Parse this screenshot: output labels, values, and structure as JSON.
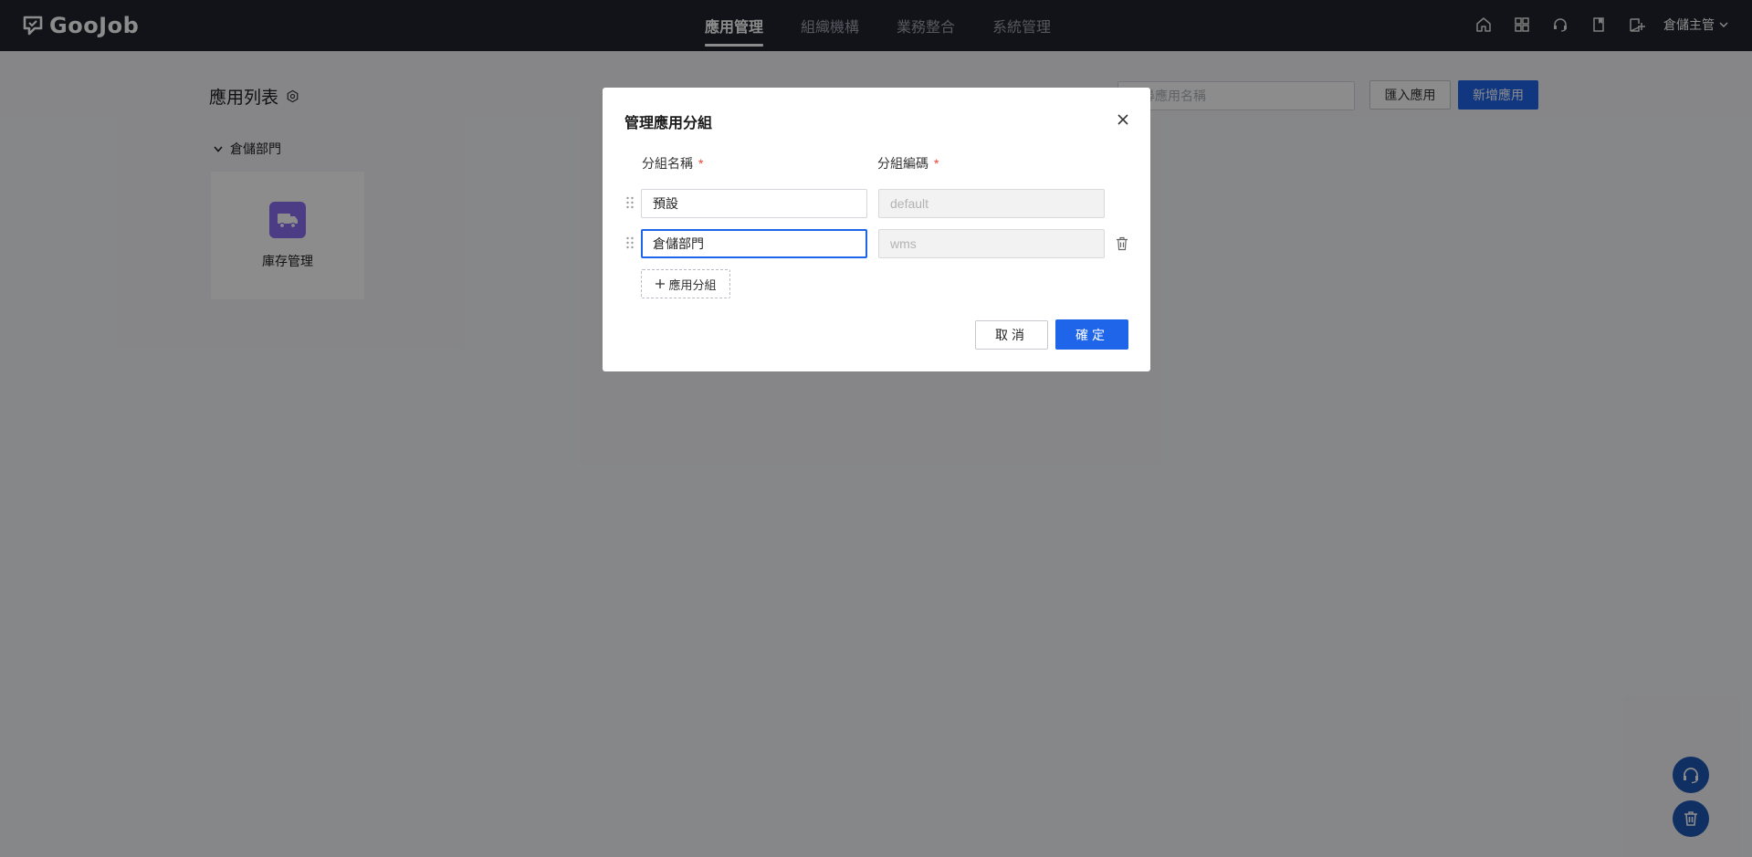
{
  "app": {
    "logo_text": "GooJob"
  },
  "nav": {
    "items": [
      {
        "label": "應用管理",
        "active": true
      },
      {
        "label": "組織機構",
        "active": false
      },
      {
        "label": "業務整合",
        "active": false
      },
      {
        "label": "系統管理",
        "active": false
      }
    ]
  },
  "header_icons": [
    "home-icon",
    "grid-icon",
    "headset-icon",
    "book-icon",
    "add-app-icon"
  ],
  "user": {
    "name": "倉儲主管"
  },
  "page": {
    "title": "應用列表",
    "search_placeholder": "搜尋應用名稱",
    "import_button": "匯入應用",
    "new_button": "新增應用",
    "group": {
      "name": "倉儲部門",
      "apps": [
        {
          "name": "庫存管理",
          "icon": "truck-icon",
          "color": "#8b6cf2"
        }
      ]
    }
  },
  "modal": {
    "title": "管理應用分組",
    "col_name_label": "分組名稱",
    "col_code_label": "分組編碼",
    "required_mark": "*",
    "rows": [
      {
        "name": "預設",
        "code": "default",
        "deletable": false
      },
      {
        "name": "倉儲部門",
        "code": "wms",
        "deletable": true
      }
    ],
    "add_group_button": "應用分組",
    "cancel_button": "取消",
    "ok_button": "確定"
  },
  "colors": {
    "primary": "#1e65ea",
    "topbar": "#21232d",
    "required": "#f04134"
  }
}
